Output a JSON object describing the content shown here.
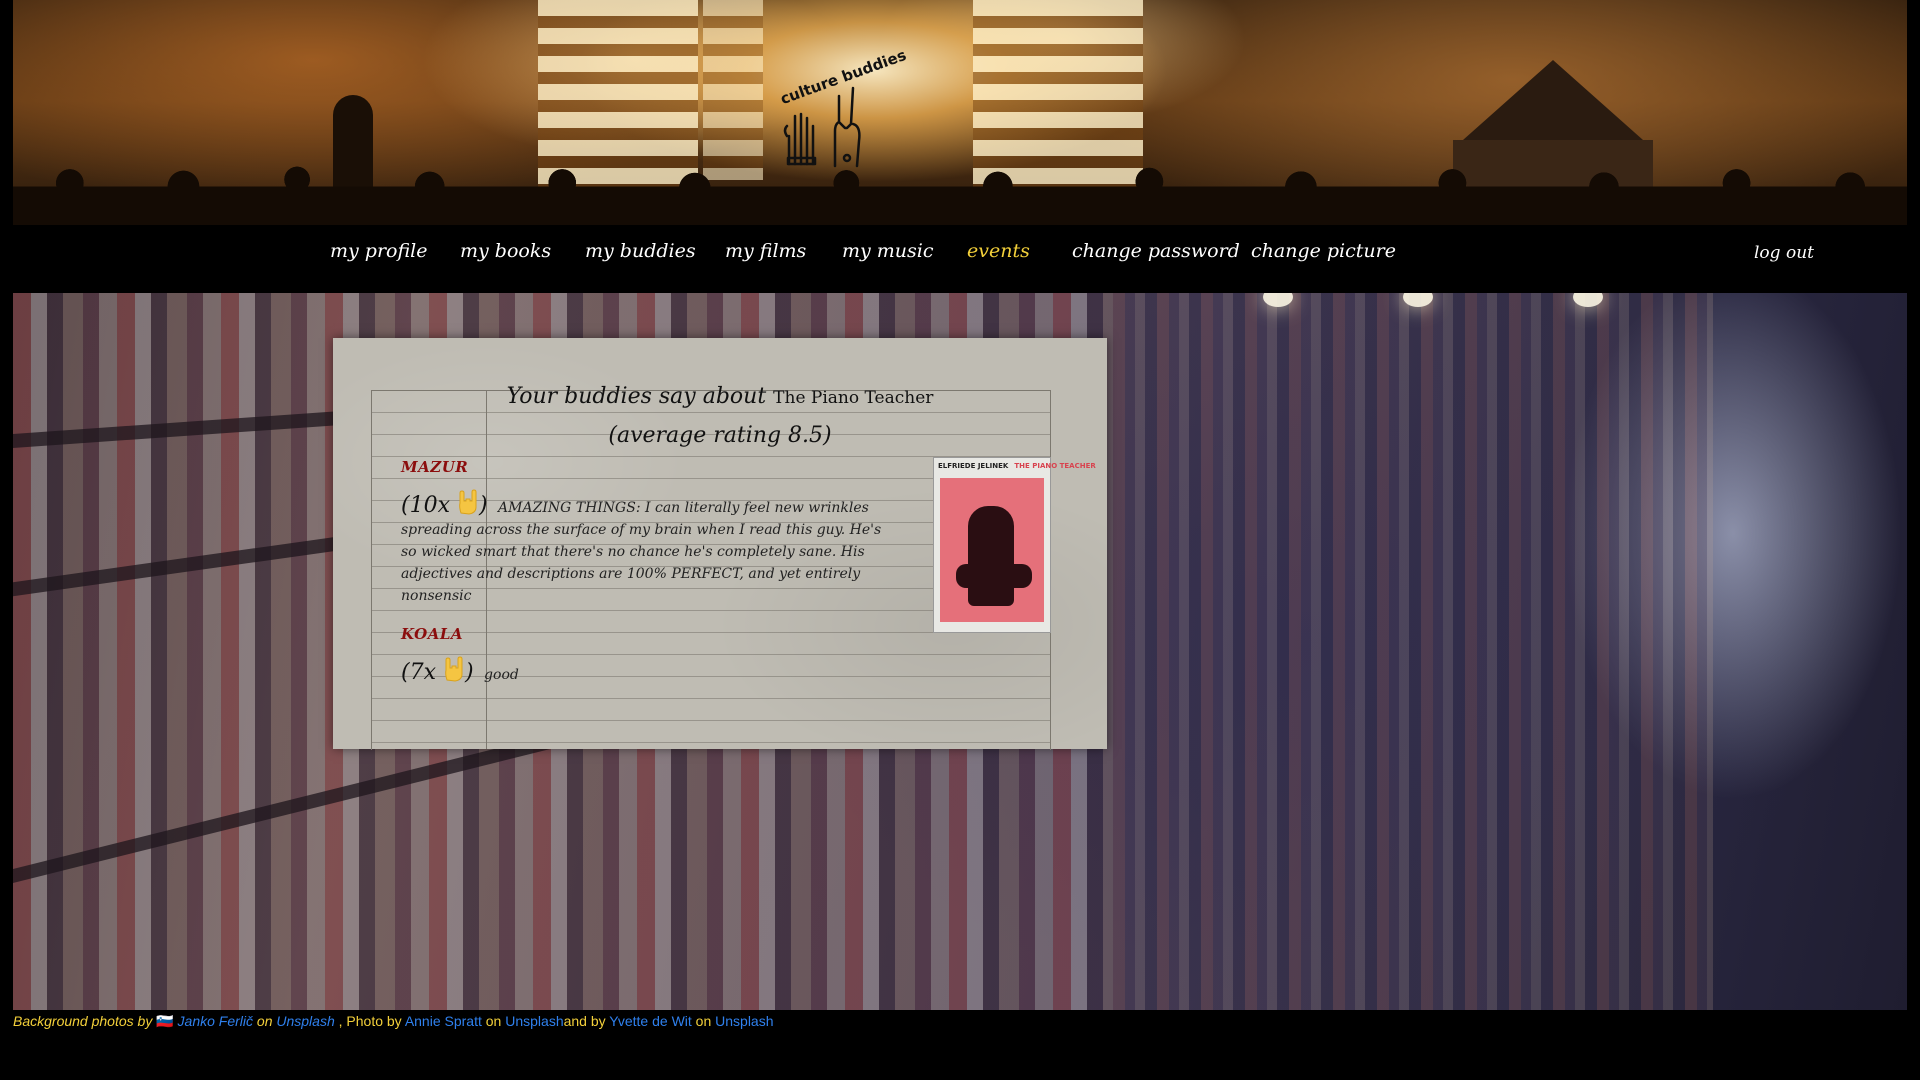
{
  "header": {
    "logo_text": "culture buddies"
  },
  "nav": {
    "items": [
      {
        "label": "my profile"
      },
      {
        "label": "my books"
      },
      {
        "label": "my buddies"
      },
      {
        "label": "my films"
      },
      {
        "label": "my music"
      },
      {
        "label": "events",
        "active": true
      },
      {
        "label": "change password"
      },
      {
        "label": "change picture"
      }
    ],
    "logout": "log out",
    "active_color": "#f3d03a"
  },
  "review_card": {
    "title_prefix": "Your buddies say about",
    "book_title": "The Piano Teacher",
    "average_rating": "(average rating 8.5)",
    "cover": {
      "author": "ELFRIEDE JELINEK",
      "title": "THE PIANO TEACHER"
    },
    "reviews": [
      {
        "name": "MAZUR",
        "count_open": "(10x",
        "count_close": ")",
        "text": "AMAZING THINGS: I can literally feel new wrinkles spreading across the surface of my brain when I read this guy. He's so wicked smart that there's no chance he's completely sane. His adjectives and descriptions are 100% PERFECT, and yet entirely nonsensic"
      },
      {
        "name": "KOALA",
        "count_open": "(7x",
        "count_close": ")",
        "text": "good"
      }
    ],
    "name_color": "#8b0d0d",
    "hand_icon": "rock-hand-icon"
  },
  "footer": {
    "prefix": "Background photos by",
    "flag": "🇸🇮",
    "person1": "Janko Ferlič",
    "on1": "on",
    "site1": "Unsplash",
    "mid": ", Photo by",
    "person2": "Annie Spratt",
    "on2": "on",
    "site2": "Unsplash",
    "and_by": "and by",
    "person3": "Yvette de Wit",
    "on3": "on",
    "site3": "Unsplash",
    "text_color": "#f3d03a",
    "link_color": "#2f80ed"
  }
}
